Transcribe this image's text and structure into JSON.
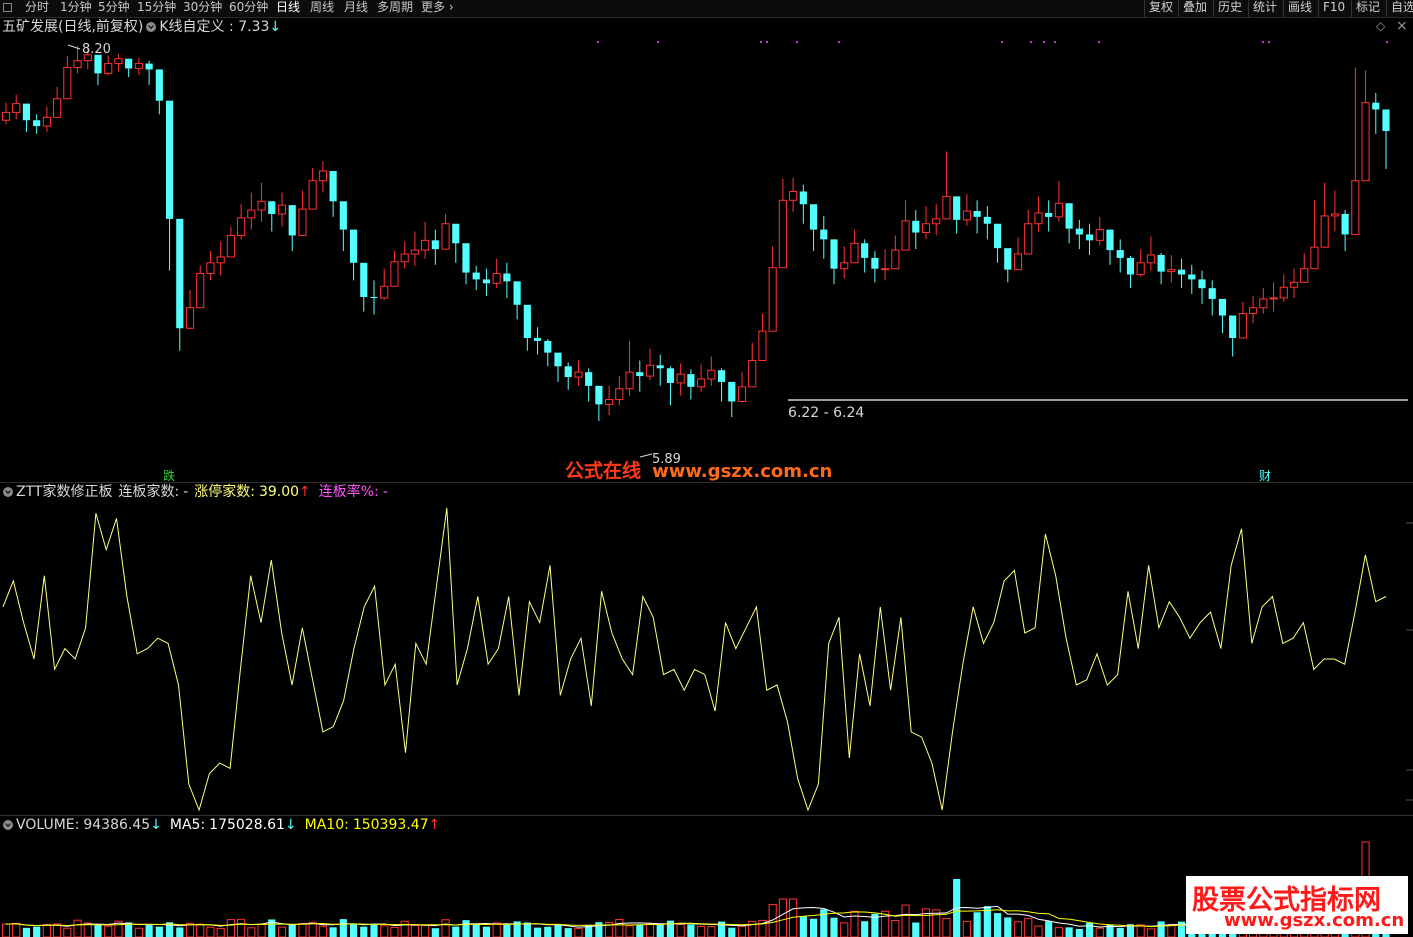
{
  "toolbar": {
    "tabs": [
      "分时",
      "1分钟",
      "5分钟",
      "15分钟",
      "30分钟",
      "60分钟",
      "日线",
      "周线",
      "月线",
      "多周期",
      "更多"
    ],
    "active_tab": "日线",
    "right_buttons": [
      "复权",
      "叠加",
      "历史",
      "统计",
      "画线",
      "F10",
      "标记",
      "自选"
    ]
  },
  "price_panel": {
    "stock_title": "五矿发展(日线,前复权)",
    "indicator_name": "K线自定义",
    "indicator_value": "7.33",
    "indicator_arrow": "↓",
    "high_label": "8.20",
    "low_label": "5.89",
    "range_label": "6.22 - 6.24",
    "event_marker_left": "跌",
    "event_marker_right": "财"
  },
  "watermark_center": {
    "cn": "公式在线",
    "url": "www.gszx.com.cn"
  },
  "ztt_panel": {
    "name": "ZTT家数修正板",
    "lianban_label": "连板家数:",
    "lianban_value": "-",
    "zhangting_label": "涨停家数:",
    "zhangting_value": "39.00",
    "zhangting_arrow": "↑",
    "lianban_rate_label": "连板率%:",
    "lianban_rate_value": "-"
  },
  "volume_panel": {
    "volume_label": "VOLUME:",
    "volume_value": "94386.45",
    "volume_arrow": "↓",
    "ma5_label": "MA5:",
    "ma5_value": "175028.61",
    "ma5_arrow": "↓",
    "ma10_label": "MA10:",
    "ma10_value": "150393.47",
    "ma10_arrow": "↑"
  },
  "watermark_corner": {
    "cn": "股票公式指标网",
    "url": "www.gszx.com.cn"
  },
  "colors": {
    "up": "#ff3232",
    "down": "#54ffff",
    "ztt_line": "#ffff80",
    "ma5": "#ffffff",
    "ma10": "#ffff00",
    "lianban_rate": "#ff55ff",
    "range_line": "#9a9a9a"
  },
  "chart_data": [
    {
      "type": "candlestick",
      "title": "五矿发展(日线,前复权)",
      "series": [
        {
          "name": "K线自定义",
          "close": [
            7.52,
            7.61,
            7.44,
            7.38,
            7.47,
            7.66,
            7.98,
            8.05,
            8.11,
            7.92,
            8.02,
            8.07,
            7.97,
            8.02,
            7.96,
            7.64,
            6.43,
            5.31,
            5.52,
            5.87,
            5.98,
            6.04,
            6.26,
            6.44,
            6.52,
            6.61,
            6.48,
            6.57,
            6.26,
            6.53,
            6.82,
            6.92,
            6.61,
            6.32,
            5.98,
            5.63,
            5.62,
            5.74,
            5.99,
            6.07,
            6.11,
            6.21,
            6.12,
            6.38,
            6.18,
            5.88,
            5.81,
            5.77,
            5.87,
            5.79,
            5.55,
            5.21,
            5.18,
            5.06,
            4.92,
            4.81,
            4.86,
            4.72,
            4.53,
            4.58,
            4.69,
            4.86,
            4.82,
            4.93,
            4.9,
            4.75,
            4.84,
            4.71,
            4.79,
            4.88,
            4.76,
            4.56,
            4.71,
            4.98,
            5.28,
            5.93,
            6.62,
            6.71,
            6.58,
            6.32,
            6.22,
            5.92,
            5.98,
            6.18,
            6.03,
            5.92,
            5.92,
            6.11,
            6.41,
            6.29,
            6.38,
            6.43,
            6.66,
            6.42,
            6.51,
            6.45,
            6.38,
            6.13,
            5.91,
            6.07,
            6.38,
            6.49,
            6.45,
            6.59,
            6.33,
            6.27,
            6.21,
            6.32,
            6.11,
            6.03,
            5.86,
            5.98,
            6.06,
            5.89,
            5.91,
            5.86,
            5.81,
            5.72,
            5.61,
            5.44,
            5.21,
            5.46,
            5.52,
            5.61,
            5.62,
            5.73,
            5.78,
            5.92,
            6.14,
            6.46,
            6.48,
            6.27,
            6.82,
            7.62,
            7.55,
            7.33
          ],
          "high": [
            7.62,
            7.7,
            7.55,
            7.5,
            7.58,
            7.78,
            8.1,
            8.2,
            8.18,
            8.05,
            8.1,
            8.12,
            8.05,
            8.08,
            8.05,
            7.8,
            6.6,
            5.6,
            5.7,
            5.95,
            6.1,
            6.2,
            6.35,
            6.58,
            6.7,
            6.8,
            6.6,
            6.7,
            6.45,
            6.72,
            6.95,
            7.02,
            6.8,
            6.5,
            6.1,
            5.78,
            5.8,
            5.92,
            6.1,
            6.2,
            6.3,
            6.4,
            6.32,
            6.48,
            6.36,
            6.06,
            5.95,
            5.92,
            6.02,
            5.98,
            5.72,
            5.36,
            5.32,
            5.2,
            5.06,
            4.96,
            4.98,
            4.9,
            4.7,
            4.72,
            4.82,
            5.18,
            4.98,
            5.1,
            5.04,
            4.92,
            4.95,
            4.89,
            4.94,
            5.02,
            4.9,
            4.72,
            4.86,
            5.16,
            5.46,
            6.15,
            6.84,
            6.85,
            6.78,
            6.52,
            6.46,
            6.14,
            6.15,
            6.32,
            6.22,
            6.1,
            6.12,
            6.26,
            6.62,
            6.52,
            6.56,
            6.58,
            7.12,
            6.66,
            6.68,
            6.62,
            6.56,
            6.35,
            6.12,
            6.24,
            6.52,
            6.66,
            6.62,
            6.82,
            6.52,
            6.42,
            6.38,
            6.45,
            6.32,
            6.22,
            6.05,
            6.12,
            6.25,
            6.08,
            6.06,
            6.02,
            5.96,
            5.9,
            5.8,
            5.6,
            5.4,
            5.58,
            5.64,
            5.72,
            5.78,
            5.86,
            5.92,
            6.08,
            6.62,
            6.8,
            6.72,
            6.52,
            7.98,
            7.95,
            7.72,
            7.52
          ],
          "low": [
            7.4,
            7.45,
            7.32,
            7.3,
            7.32,
            7.52,
            7.85,
            7.92,
            7.96,
            7.8,
            7.9,
            7.94,
            7.88,
            7.9,
            7.8,
            7.5,
            5.9,
            5.08,
            5.3,
            5.62,
            5.8,
            5.85,
            6.05,
            6.22,
            6.32,
            6.4,
            6.3,
            6.35,
            6.1,
            6.3,
            6.6,
            6.7,
            6.45,
            6.1,
            5.8,
            5.48,
            5.45,
            5.6,
            5.8,
            5.92,
            5.95,
            6.02,
            5.96,
            6.12,
            5.98,
            5.76,
            5.7,
            5.64,
            5.72,
            5.62,
            5.4,
            5.08,
            5.04,
            4.92,
            4.76,
            4.68,
            4.72,
            4.56,
            4.36,
            4.42,
            4.52,
            4.62,
            4.66,
            4.78,
            4.72,
            4.52,
            4.62,
            4.58,
            4.66,
            4.72,
            4.56,
            4.4,
            4.55,
            4.78,
            5.1,
            5.62,
            6.22,
            6.5,
            6.38,
            6.1,
            6.02,
            5.76,
            5.82,
            5.98,
            5.88,
            5.78,
            5.8,
            5.95,
            6.22,
            6.12,
            6.22,
            6.26,
            6.46,
            6.28,
            6.36,
            6.28,
            6.22,
            5.98,
            5.78,
            5.92,
            6.22,
            6.3,
            6.3,
            6.4,
            6.18,
            6.12,
            6.06,
            6.16,
            5.96,
            5.88,
            5.72,
            5.84,
            5.9,
            5.76,
            5.78,
            5.72,
            5.66,
            5.56,
            5.44,
            5.26,
            5.02,
            5.28,
            5.36,
            5.46,
            5.48,
            5.58,
            5.62,
            5.78,
            6.0,
            6.26,
            6.3,
            6.1,
            6.62,
            7.12,
            7.3,
            6.94
          ]
        }
      ],
      "annotations": [
        "8.20",
        "5.89",
        "6.22 - 6.24"
      ]
    },
    {
      "type": "line",
      "title": "ZTT家数修正板",
      "series": [
        {
          "name": "涨停家数",
          "values": [
            55,
            60,
            52,
            45,
            61,
            43,
            47,
            45,
            51,
            73,
            66,
            72,
            57,
            46,
            47,
            49,
            48,
            40,
            21,
            16,
            23,
            25,
            24,
            43,
            61,
            52,
            64,
            50,
            40,
            51,
            41,
            31,
            32,
            37,
            47,
            55,
            59,
            40,
            44,
            27,
            48,
            44,
            59,
            74,
            40,
            47,
            57,
            44,
            47,
            57,
            38,
            56,
            52,
            63,
            38,
            45,
            49,
            36,
            58,
            50,
            45,
            42,
            57,
            53,
            42,
            43,
            39,
            43,
            42,
            35,
            52,
            47,
            51,
            55,
            39,
            40,
            33,
            22,
            16,
            21,
            48,
            53,
            26,
            46,
            36,
            55,
            39,
            53,
            31,
            30,
            25,
            16,
            31,
            44,
            55,
            48,
            52,
            60,
            62,
            50,
            51,
            69,
            61,
            49,
            40,
            41,
            46,
            40,
            42,
            58,
            47,
            63,
            51,
            56,
            53,
            49,
            52,
            54,
            47,
            63,
            70,
            48,
            55,
            57,
            48,
            49,
            52,
            43,
            45,
            45,
            44,
            54,
            65,
            56,
            57
          ]
        }
      ]
    },
    {
      "type": "bar",
      "title": "VOLUME",
      "series": [
        {
          "name": "VOLUME",
          "values": [
            94386.45
          ]
        },
        {
          "name": "MA5",
          "values": [
            175028.61
          ]
        },
        {
          "name": "MA10",
          "values": [
            150393.47
          ]
        }
      ]
    }
  ]
}
